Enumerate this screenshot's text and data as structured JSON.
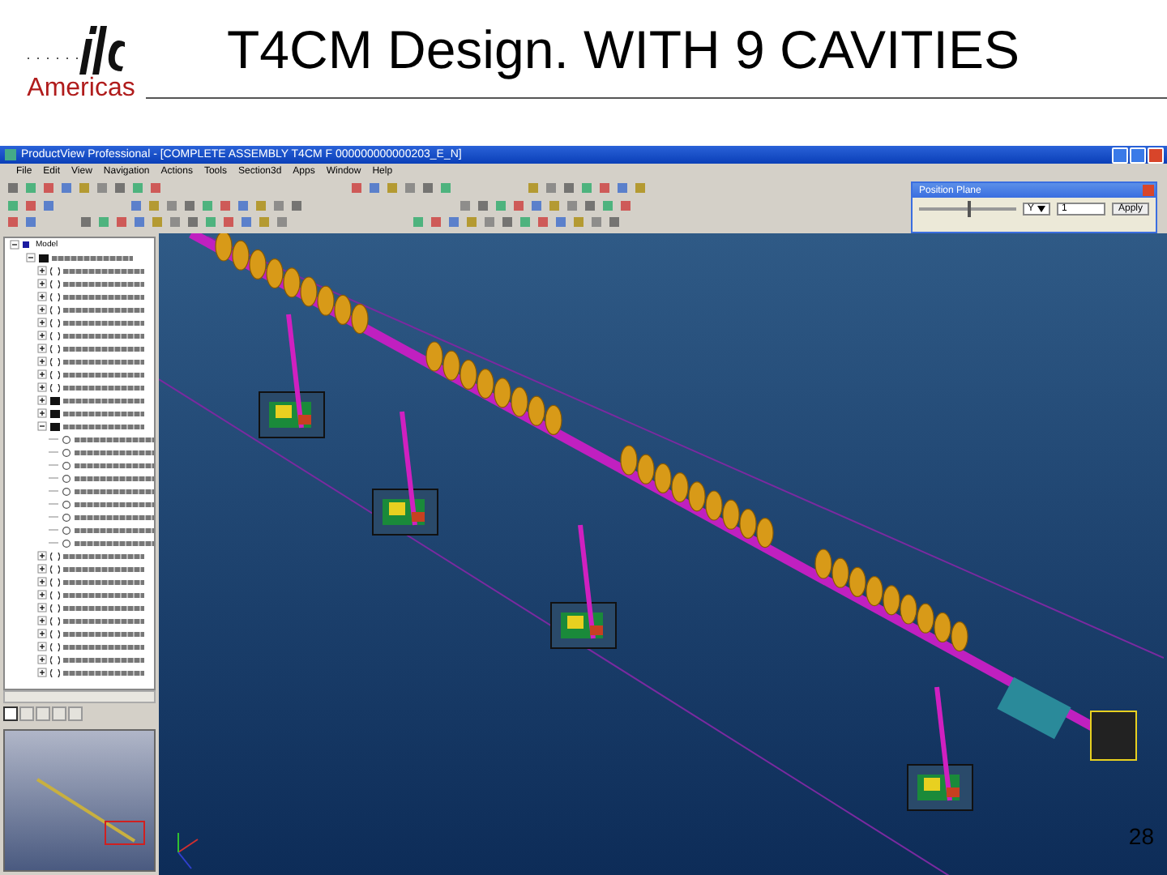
{
  "slide": {
    "logo_caption": "Americas",
    "title": "T4CM Design. WITH 9 CAVITIES",
    "page_number": "28"
  },
  "window": {
    "title": "ProductView Professional - [COMPLETE ASSEMBLY T4CM F 000000000000203_E_N]",
    "menu": [
      "File",
      "Edit",
      "View",
      "Navigation",
      "Actions",
      "Tools",
      "Section3d",
      "Apps",
      "Window",
      "Help"
    ]
  },
  "position_plane": {
    "title": "Position Plane",
    "level": 0.5,
    "axis": "Y",
    "value": "1",
    "apply": "Apply"
  },
  "tree": {
    "root": "Model",
    "children": [
      {
        "kind": "assembly",
        "expanded": true,
        "children": [
          {
            "kind": "part",
            "expanded": false
          },
          {
            "kind": "part",
            "expanded": false
          },
          {
            "kind": "part",
            "expanded": false
          },
          {
            "kind": "part",
            "expanded": false
          },
          {
            "kind": "part",
            "expanded": false
          },
          {
            "kind": "part",
            "expanded": false
          },
          {
            "kind": "part",
            "expanded": false
          },
          {
            "kind": "part",
            "expanded": false
          },
          {
            "kind": "part",
            "expanded": false
          },
          {
            "kind": "part",
            "expanded": false
          },
          {
            "kind": "assembly",
            "expanded": false
          },
          {
            "kind": "assembly",
            "expanded": false
          },
          {
            "kind": "assembly",
            "expanded": true,
            "children": [
              {
                "kind": "leaf"
              },
              {
                "kind": "leaf"
              },
              {
                "kind": "leaf"
              },
              {
                "kind": "leaf"
              },
              {
                "kind": "leaf"
              },
              {
                "kind": "leaf"
              },
              {
                "kind": "leaf"
              },
              {
                "kind": "leaf"
              },
              {
                "kind": "leaf"
              }
            ]
          },
          {
            "kind": "part",
            "expanded": false
          },
          {
            "kind": "part",
            "expanded": false
          },
          {
            "kind": "part",
            "expanded": false
          },
          {
            "kind": "part",
            "expanded": false
          },
          {
            "kind": "part",
            "expanded": false
          },
          {
            "kind": "part",
            "expanded": false
          },
          {
            "kind": "part",
            "expanded": false
          },
          {
            "kind": "part",
            "expanded": false
          },
          {
            "kind": "part",
            "expanded": false
          },
          {
            "kind": "part",
            "expanded": false
          }
        ]
      }
    ]
  },
  "panel_tabs": [
    {
      "selected": true
    },
    {
      "selected": false
    },
    {
      "selected": false
    },
    {
      "selected": false
    },
    {
      "selected": false
    }
  ]
}
